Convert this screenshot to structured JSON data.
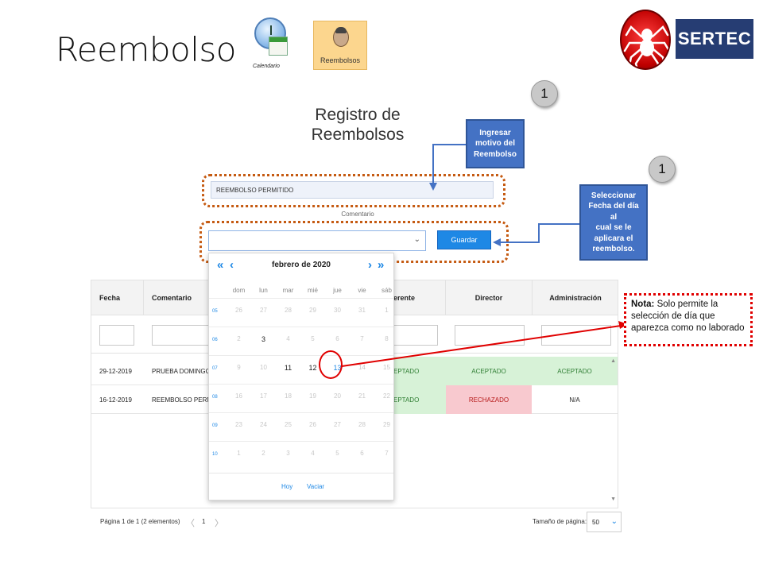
{
  "page_title": "Reembolso",
  "toolbar": {
    "calendar_caption": "Calendario",
    "refunds_caption": "Reembolsos"
  },
  "brand": {
    "name": "SERTEC"
  },
  "steps": {
    "badge_1": "1",
    "badge_2": "1"
  },
  "form": {
    "title_line1": "Registro de",
    "title_line2": "Reembolsos",
    "comment_value": "REEMBOLSO PERMITIDO",
    "comment_label": "Comentario",
    "date_value": "",
    "save_label": "Guardar"
  },
  "callouts": {
    "reason": [
      "Ingresar",
      "motivo del",
      "Reembolso"
    ],
    "date": [
      "Seleccionar",
      "Fecha del día al",
      "cual se le",
      "aplicara el",
      "reembolso."
    ]
  },
  "note": {
    "bold": "Nota:",
    "text": " Solo permite la selección de día que aparezca como no laborado"
  },
  "grid": {
    "columns": [
      "Fecha",
      "Comentario",
      "Gerente",
      "Director",
      "Administración"
    ],
    "visible_headers": {
      "fecha": "Fecha",
      "comentario": "Comentario",
      "gerente": "erente",
      "director": "Director",
      "administracion": "Administración"
    },
    "rows": [
      {
        "fecha": "29-12-2019",
        "comentario": "PRUEBA DOMINGO",
        "gerente": "EPTADO",
        "director": "ACEPTADO",
        "administracion": "ACEPTADO"
      },
      {
        "fecha": "16-12-2019",
        "comentario": "REEMBOLSO PERMITI",
        "gerente": "EPTADO",
        "director": "RECHAZADO",
        "administracion": "N/A"
      }
    ]
  },
  "calendar": {
    "month_label": "febrero de 2020",
    "nav": {
      "prev_year": "«",
      "prev_month": "‹",
      "next_month": "›",
      "next_year": "»"
    },
    "weekdays": [
      "dom",
      "lun",
      "mar",
      "mié",
      "jue",
      "vie",
      "sáb"
    ],
    "weeks": [
      {
        "num": "05",
        "days": [
          {
            "d": "26",
            "enabled": false
          },
          {
            "d": "27",
            "enabled": false
          },
          {
            "d": "28",
            "enabled": false
          },
          {
            "d": "29",
            "enabled": false
          },
          {
            "d": "30",
            "enabled": false
          },
          {
            "d": "31",
            "enabled": false
          },
          {
            "d": "1",
            "enabled": false
          }
        ]
      },
      {
        "num": "06",
        "days": [
          {
            "d": "2",
            "enabled": false
          },
          {
            "d": "3",
            "enabled": true
          },
          {
            "d": "4",
            "enabled": false
          },
          {
            "d": "5",
            "enabled": false
          },
          {
            "d": "6",
            "enabled": false
          },
          {
            "d": "7",
            "enabled": false
          },
          {
            "d": "8",
            "enabled": false
          }
        ]
      },
      {
        "num": "07",
        "days": [
          {
            "d": "9",
            "enabled": false
          },
          {
            "d": "10",
            "enabled": false
          },
          {
            "d": "11",
            "enabled": true
          },
          {
            "d": "12",
            "enabled": true
          },
          {
            "d": "13",
            "enabled": true,
            "selected": true
          },
          {
            "d": "14",
            "enabled": false
          },
          {
            "d": "15",
            "enabled": false
          }
        ]
      },
      {
        "num": "08",
        "days": [
          {
            "d": "16",
            "enabled": false
          },
          {
            "d": "17",
            "enabled": false
          },
          {
            "d": "18",
            "enabled": false
          },
          {
            "d": "19",
            "enabled": false
          },
          {
            "d": "20",
            "enabled": false
          },
          {
            "d": "21",
            "enabled": false
          },
          {
            "d": "22",
            "enabled": false
          }
        ]
      },
      {
        "num": "09",
        "days": [
          {
            "d": "23",
            "enabled": false
          },
          {
            "d": "24",
            "enabled": false
          },
          {
            "d": "25",
            "enabled": false
          },
          {
            "d": "26",
            "enabled": false
          },
          {
            "d": "27",
            "enabled": false
          },
          {
            "d": "28",
            "enabled": false
          },
          {
            "d": "29",
            "enabled": false
          }
        ]
      },
      {
        "num": "10",
        "days": [
          {
            "d": "1",
            "enabled": false
          },
          {
            "d": "2",
            "enabled": false
          },
          {
            "d": "3",
            "enabled": false
          },
          {
            "d": "4",
            "enabled": false
          },
          {
            "d": "5",
            "enabled": false
          },
          {
            "d": "6",
            "enabled": false
          },
          {
            "d": "7",
            "enabled": false
          }
        ]
      }
    ],
    "today_label": "Hoy",
    "clear_label": "Vaciar"
  },
  "pager": {
    "summary": "Página 1 de 1 (2 elementos)",
    "prev": "〈",
    "current": "1",
    "next": "〉",
    "size_label": "Tamaño de página:",
    "size_value": "50",
    "dropdown_chevron": "⌄"
  },
  "colors": {
    "accent": "#1e88e5",
    "callout": "#4472c4",
    "accepted": "#d7f2d7",
    "rejected": "#f8c9cf",
    "frame": "#c55a11",
    "note_border": "#e00000",
    "brand": "#263d73"
  }
}
